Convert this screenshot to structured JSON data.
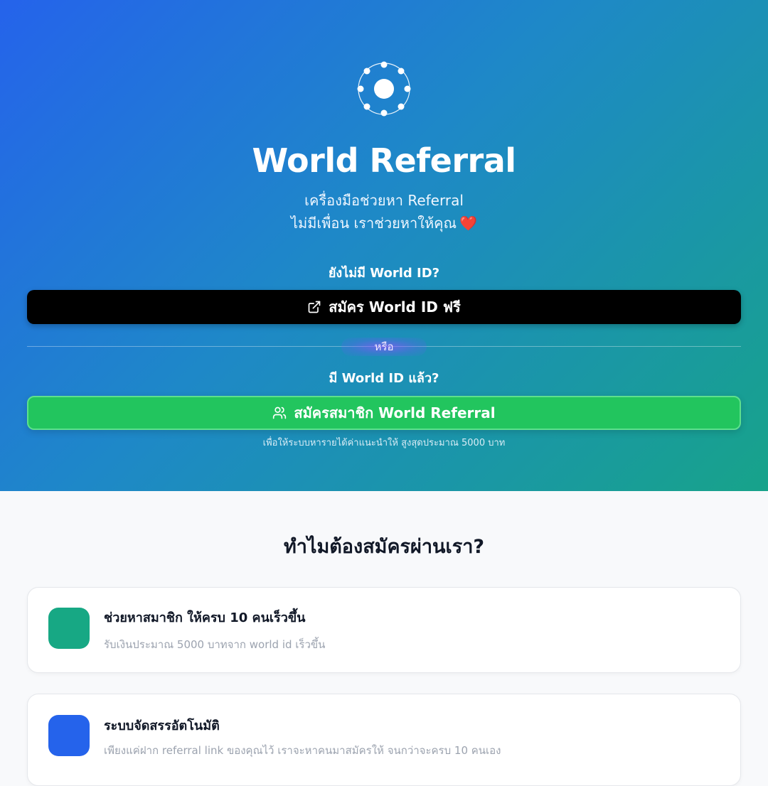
{
  "hero": {
    "logo_icon": "globe-network-icon",
    "title": "World Referral",
    "subtitle_line1": "เครื่องมือช่วยหา Referral",
    "subtitle_line2": "ไม่มีเพื่อน เราช่วยหาให้คุณ",
    "heart": "❤️",
    "no_id_question": "ยังไม่มี World ID?",
    "register_world_id_button": "สมัคร World ID ฟรี",
    "register_world_id_icon": "external-link-icon",
    "or_label": "หรือ",
    "has_id_question": "มี World ID แล้ว?",
    "join_button": "สมัครสมาชิก World Referral",
    "join_button_icon": "users-icon",
    "note": "เพื่อให้ระบบหารายได้ค่าแนะนำให้ สูงสุดประมาณ 5000 บาท"
  },
  "why": {
    "heading": "ทำไมต้องสมัครผ่านเรา?",
    "features": [
      {
        "title": "ช่วยหาสมาชิก ให้ครบ 10 คนเร็วขึ้น",
        "description": "รับเงินประมาณ 5000 บาทจาก world id เร็วขึ้น",
        "icon_color": "#17a884"
      },
      {
        "title": "ระบบจัดสรรอัตโนมัติ",
        "description": "เพียงแค่ฝาก referral link ของคุณไว้ เราจะหาคนมาสมัครให้ จนกว่าจะครบ 10 คนเอง",
        "icon_color": "#2563eb"
      }
    ]
  },
  "colors": {
    "gradient_start": "#2563eb",
    "gradient_end": "#17a38a",
    "black_button": "#000000",
    "green_button": "#22c55e"
  }
}
